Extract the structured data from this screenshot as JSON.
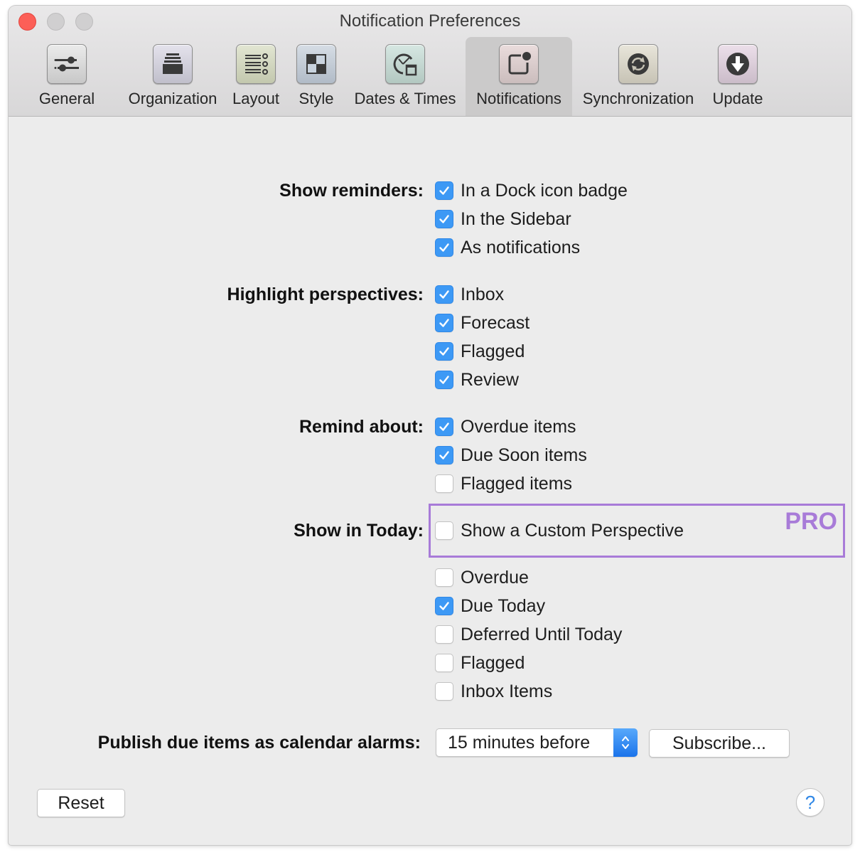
{
  "window": {
    "title": "Notification Preferences"
  },
  "toolbar": {
    "items": [
      {
        "label": "General",
        "icon": "sliders-icon",
        "selected": false
      },
      {
        "label": "Organization",
        "icon": "stacked-trays-icon",
        "selected": false
      },
      {
        "label": "Layout",
        "icon": "list-columns-icon",
        "selected": false
      },
      {
        "label": "Style",
        "icon": "checkerboard-icon",
        "selected": false
      },
      {
        "label": "Dates & Times",
        "icon": "clock-calendar-icon",
        "selected": false
      },
      {
        "label": "Notifications",
        "icon": "notification-badge-icon",
        "selected": true
      },
      {
        "label": "Synchronization",
        "icon": "sync-icon",
        "selected": false
      },
      {
        "label": "Update",
        "icon": "download-arrow-icon",
        "selected": false
      }
    ]
  },
  "groups": {
    "show_reminders": {
      "label": "Show reminders:",
      "options": [
        {
          "label": "In a Dock icon badge",
          "checked": true
        },
        {
          "label": "In the Sidebar",
          "checked": true
        },
        {
          "label": "As notifications",
          "checked": true
        }
      ]
    },
    "highlight_perspectives": {
      "label": "Highlight perspectives:",
      "options": [
        {
          "label": "Inbox",
          "checked": true
        },
        {
          "label": "Forecast",
          "checked": true
        },
        {
          "label": "Flagged",
          "checked": true
        },
        {
          "label": "Review",
          "checked": true
        }
      ]
    },
    "remind_about": {
      "label": "Remind about:",
      "options": [
        {
          "label": "Overdue items",
          "checked": true
        },
        {
          "label": "Due Soon items",
          "checked": true
        },
        {
          "label": "Flagged items",
          "checked": false
        }
      ]
    },
    "show_in_today": {
      "label": "Show in Today:",
      "pro_badge": "PRO",
      "custom_perspective": {
        "label": "Show a Custom Perspective",
        "checked": false
      },
      "options": [
        {
          "label": "Overdue",
          "checked": false
        },
        {
          "label": "Due Today",
          "checked": true
        },
        {
          "label": "Deferred Until Today",
          "checked": false
        },
        {
          "label": "Flagged",
          "checked": false
        },
        {
          "label": "Inbox Items",
          "checked": false
        }
      ]
    }
  },
  "publish": {
    "label": "Publish due items as calendar alarms:",
    "selected_value": "15 minutes before",
    "subscribe_label": "Subscribe..."
  },
  "footer": {
    "reset_label": "Reset",
    "help_label": "?"
  },
  "colors": {
    "accent": "#3d99f5",
    "pro": "#a87bd8",
    "close": "#fc5f57"
  }
}
